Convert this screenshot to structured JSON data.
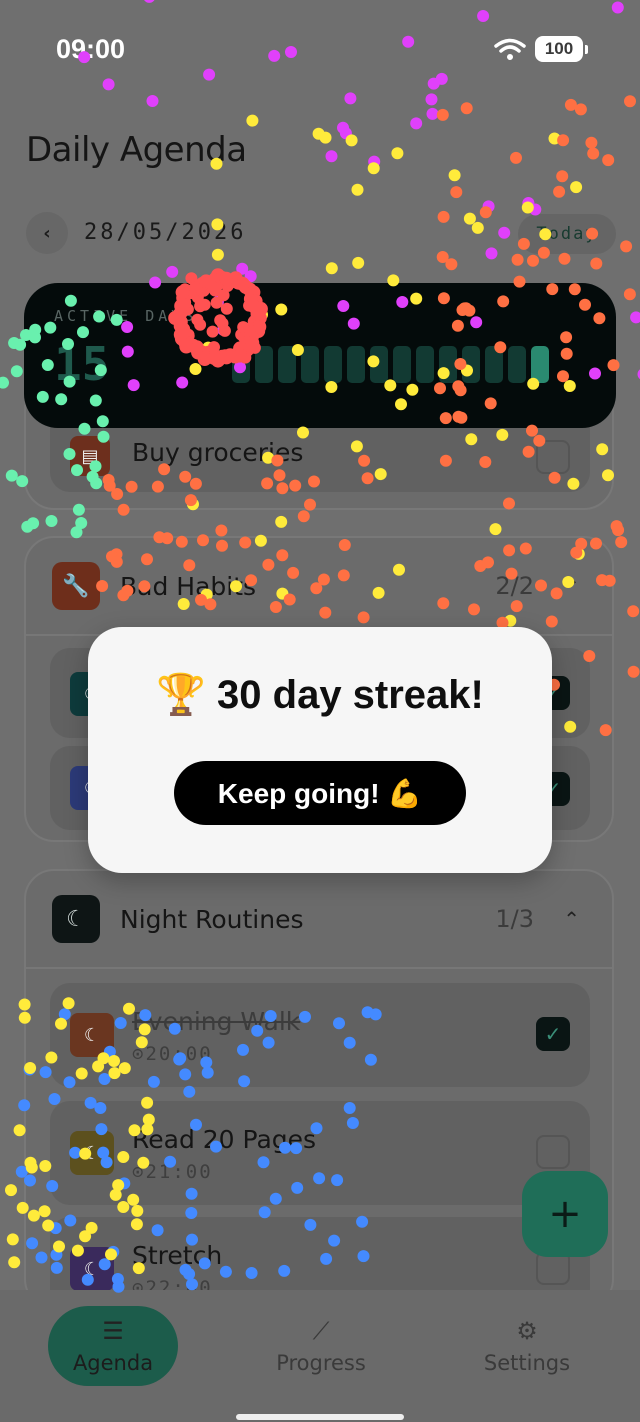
{
  "status_bar": {
    "time": "09:00",
    "battery": "100"
  },
  "header": {
    "title": "Daily Agenda"
  },
  "date_nav": {
    "prev": "‹",
    "date": "28/05/2026",
    "today": "Today"
  },
  "active_days": {
    "label": "ACTIVE DAYS",
    "count": "15",
    "filled_bars": 14,
    "total_bars": 14
  },
  "sections": [
    {
      "name": "Bad Habits",
      "count": "2/2",
      "icon": "wrench-icon",
      "color": "#6e2e1b"
    },
    {
      "name": "Night Routines",
      "count": "1/3",
      "icon": "moon-icon",
      "color": "#0e1515"
    }
  ],
  "tasks_top": [
    {
      "title": "Buy groceries",
      "icon": "document-icon",
      "done": false
    }
  ],
  "tasks_bad": [
    {
      "title": "",
      "done": true
    },
    {
      "title": "",
      "done": true
    }
  ],
  "tasks_night": [
    {
      "title": "Evening Walk",
      "time": "20:00",
      "done": true,
      "color": "#6a3620"
    },
    {
      "title": "Read 20 Pages",
      "time": "21:00",
      "done": false,
      "color": "#5c501e"
    },
    {
      "title": "Stretch",
      "time": "22:00",
      "done": false,
      "color": "#3a2a5c"
    }
  ],
  "modal": {
    "title": "🏆 30 day streak!",
    "button": "Keep going! 💪"
  },
  "fab": {
    "label": "+"
  },
  "nav": [
    {
      "label": "Agenda",
      "icon": "agenda-icon",
      "active": true
    },
    {
      "label": "Progress",
      "icon": "progress-icon",
      "active": false
    },
    {
      "label": "Settings",
      "icon": "gear-icon",
      "active": false
    }
  ],
  "confetti_colors": [
    "#e040fb",
    "#ffeb3b",
    "#ff5252",
    "#ff7043",
    "#69f0ae",
    "#448aff"
  ]
}
